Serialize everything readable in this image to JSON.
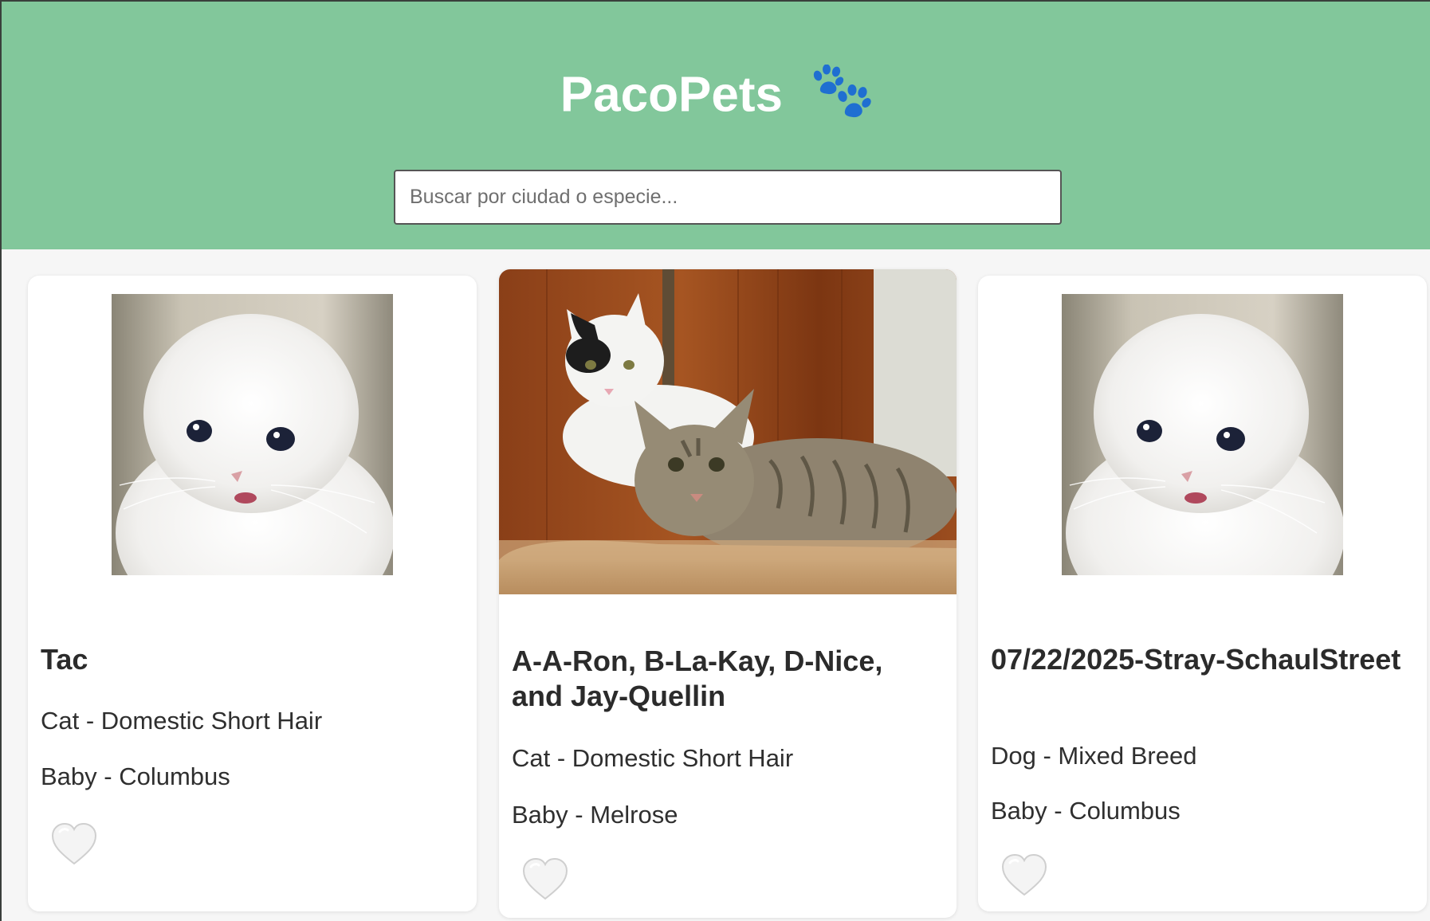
{
  "app": {
    "brand": "PacoPets",
    "brand_icon": "paw-icon",
    "colors": {
      "header_bg": "#82c79b",
      "page_bg": "#f6f6f6",
      "paw": "#1f6fd1"
    }
  },
  "search": {
    "placeholder": "Buscar por ciudad o especie...",
    "value": ""
  },
  "pets": [
    {
      "name": "Tac",
      "species_line": "Cat - Domestic Short Hair",
      "age_location": "Baby - Columbus",
      "photo": "crying-white-cat-photo",
      "favorite": false
    },
    {
      "name": "A-A-Ron, B-La-Kay, D-Nice, and Jay-Quellin",
      "species_line": "Cat - Domestic Short Hair",
      "age_location": "Baby - Melrose",
      "photo": "two-kittens-on-cat-tree-photo",
      "favorite": false
    },
    {
      "name": "07/22/2025-Stray-SchaulStreet",
      "species_line": "Dog - Mixed Breed",
      "age_location": "Baby - Columbus",
      "photo": "crying-white-cat-photo",
      "favorite": false
    }
  ]
}
